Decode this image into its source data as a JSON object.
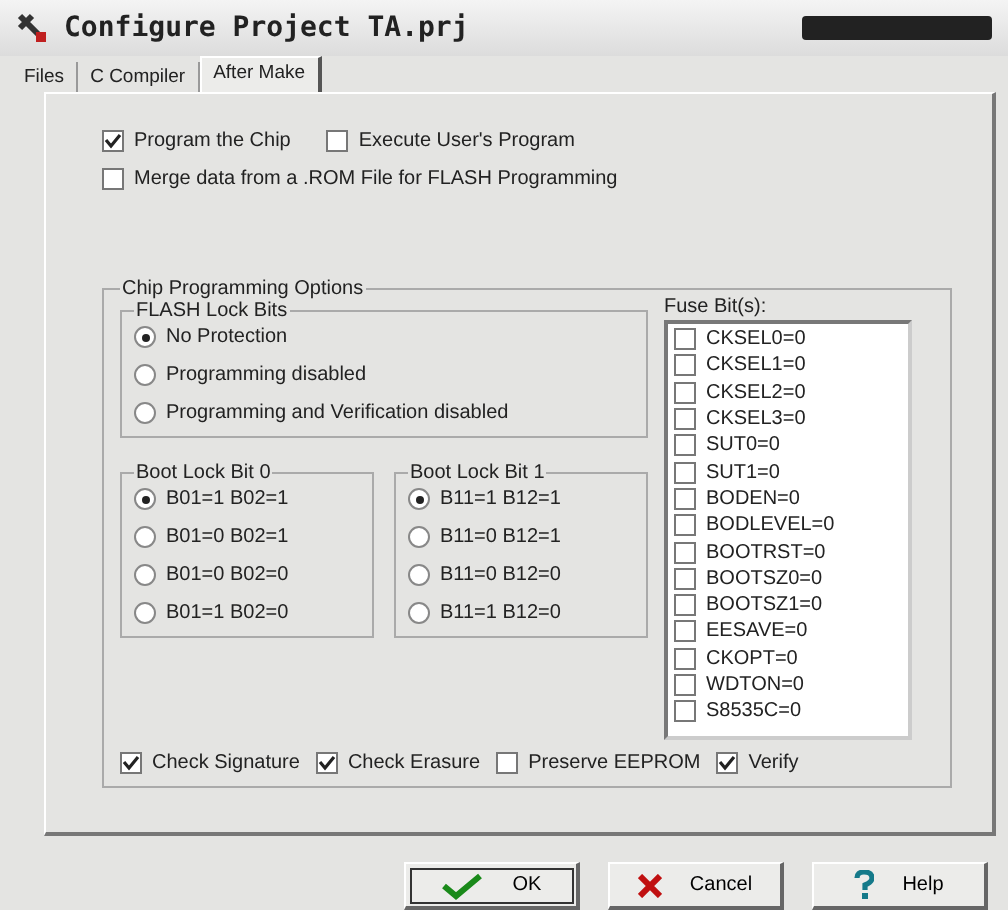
{
  "window": {
    "title": "Configure Project TA.prj"
  },
  "tabs": [
    {
      "label": "Files",
      "selected": false
    },
    {
      "label": "C Compiler",
      "selected": false
    },
    {
      "label": "After Make",
      "selected": true
    }
  ],
  "options": [
    {
      "label": "Program the Chip",
      "checked": true
    },
    {
      "label": "Execute User's Program",
      "checked": false
    },
    {
      "label": "Merge data from a .ROM File for FLASH Programming",
      "checked": false
    }
  ],
  "chip_programming": {
    "title": "Chip Programming Options",
    "flash_lock_bits": {
      "title": "FLASH Lock Bits",
      "items": [
        {
          "label": "No Protection",
          "selected": true
        },
        {
          "label": "Programming disabled",
          "selected": false
        },
        {
          "label": "Programming and Verification disabled",
          "selected": false
        }
      ]
    },
    "boot_lock_bit_0": {
      "title": "Boot Lock Bit 0",
      "items": [
        {
          "label": "B01=1 B02=1",
          "selected": true
        },
        {
          "label": "B01=0 B02=1",
          "selected": false
        },
        {
          "label": "B01=0 B02=0",
          "selected": false
        },
        {
          "label": "B01=1 B02=0",
          "selected": false
        }
      ]
    },
    "boot_lock_bit_1": {
      "title": "Boot Lock Bit 1",
      "items": [
        {
          "label": "B11=1 B12=1",
          "selected": true
        },
        {
          "label": "B11=0 B12=1",
          "selected": false
        },
        {
          "label": "B11=0 B12=0",
          "selected": false
        },
        {
          "label": "B11=1 B12=0",
          "selected": false
        }
      ]
    },
    "fuse_bits": {
      "title": "Fuse Bit(s):",
      "items": [
        {
          "label": "CKSEL0=0",
          "checked": false
        },
        {
          "label": "CKSEL1=0",
          "checked": false
        },
        {
          "label": "CKSEL2=0",
          "checked": false
        },
        {
          "label": "CKSEL3=0",
          "checked": false
        },
        {
          "label": "SUT0=0",
          "checked": false
        },
        {
          "label": "SUT1=0",
          "checked": false
        },
        {
          "label": "BODEN=0",
          "checked": false
        },
        {
          "label": "BODLEVEL=0",
          "checked": false
        },
        {
          "label": "BOOTRST=0",
          "checked": false
        },
        {
          "label": "BOOTSZ0=0",
          "checked": false
        },
        {
          "label": "BOOTSZ1=0",
          "checked": false
        },
        {
          "label": "EESAVE=0",
          "checked": false
        },
        {
          "label": "CKOPT=0",
          "checked": false
        },
        {
          "label": "WDTON=0",
          "checked": false
        },
        {
          "label": "S8535C=0",
          "checked": false
        }
      ]
    },
    "checks": [
      {
        "label": "Check Signature",
        "checked": true
      },
      {
        "label": "Check Erasure",
        "checked": true
      },
      {
        "label": "Preserve EEPROM",
        "checked": false
      },
      {
        "label": "Verify",
        "checked": true
      }
    ]
  },
  "buttons": [
    {
      "kind": "ok",
      "label": "OK",
      "selected": true
    },
    {
      "kind": "cancel",
      "label": "Cancel",
      "selected": false
    },
    {
      "kind": "help",
      "label": "Help",
      "selected": false
    }
  ]
}
